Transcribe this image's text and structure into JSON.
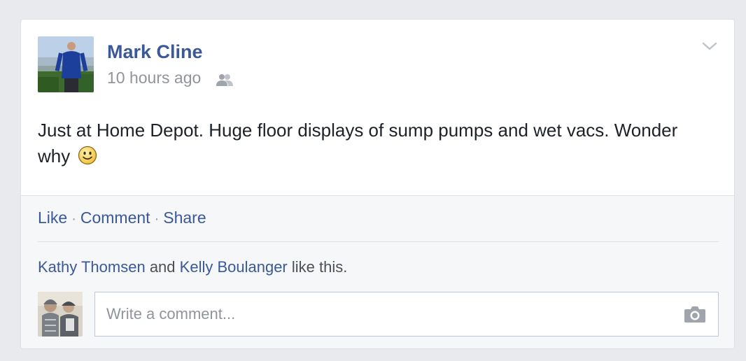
{
  "post": {
    "author": "Mark Cline",
    "timestamp": "10 hours ago",
    "audience_icon": "friends-icon",
    "text": "Just at Home Depot. Huge floor displays of sump pumps and wet vacs. Wonder why",
    "emoji": "smiley-icon"
  },
  "actions": {
    "like": "Like",
    "separator": "·",
    "comment": "Comment",
    "share": "Share"
  },
  "likes": {
    "person1": "Kathy Thomsen",
    "connector": "and",
    "person2": "Kelly Boulanger",
    "suffix": "like this."
  },
  "comment_box": {
    "placeholder": "Write a comment...",
    "attach_icon": "camera-icon"
  },
  "colors": {
    "link": "#3b5998",
    "background": "#e9eaed",
    "footer": "#f6f7f9",
    "text": "#1d2129",
    "muted": "#90949c"
  }
}
